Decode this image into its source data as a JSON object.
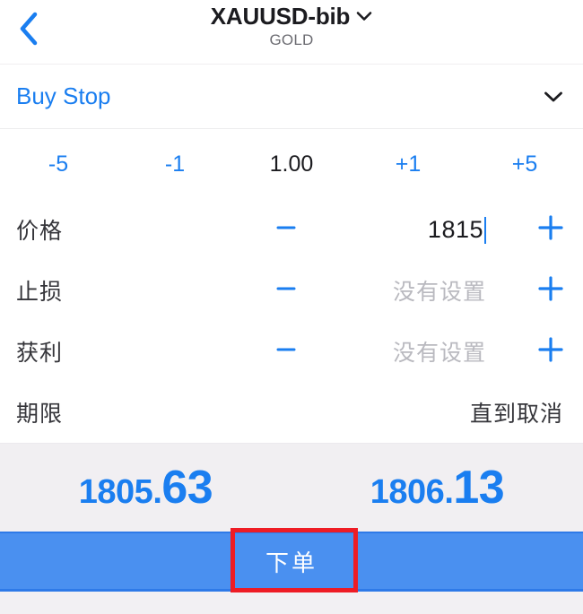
{
  "header": {
    "back_icon": "chevron-left-icon",
    "symbol": "XAUUSD-bib",
    "symbol_chevron_icon": "chevron-down-icon",
    "subtitle": "GOLD"
  },
  "order_type": {
    "label": "Buy Stop",
    "chevron_icon": "chevron-down-icon"
  },
  "volume": {
    "minus_five": "-5",
    "minus_one": "-1",
    "value": "1.00",
    "plus_one": "+1",
    "plus_five": "+5"
  },
  "fields": [
    {
      "label": "价格",
      "minus_icon": "minus-icon",
      "plus_icon": "plus-icon",
      "value": "1815",
      "placeholder": "没有设置",
      "has_caret": true
    },
    {
      "label": "止损",
      "minus_icon": "minus-icon",
      "plus_icon": "plus-icon",
      "value": "",
      "placeholder": "没有设置",
      "has_caret": false
    },
    {
      "label": "获利",
      "minus_icon": "minus-icon",
      "plus_icon": "plus-icon",
      "value": "",
      "placeholder": "没有设置",
      "has_caret": false
    }
  ],
  "expiry": {
    "label": "期限",
    "value": "直到取消"
  },
  "quote": {
    "bid_int": "1805.",
    "bid_dec": "63",
    "ask_int": "1806.",
    "ask_dec": "13"
  },
  "submit": {
    "label": "下单"
  },
  "colors": {
    "accent_blue": "#1a7ef0",
    "submit_blue": "#4a90f0",
    "annotation_red": "#ee1c25",
    "quote_bg": "#f1eff2",
    "placeholder_gray": "#b9b9bf"
  }
}
